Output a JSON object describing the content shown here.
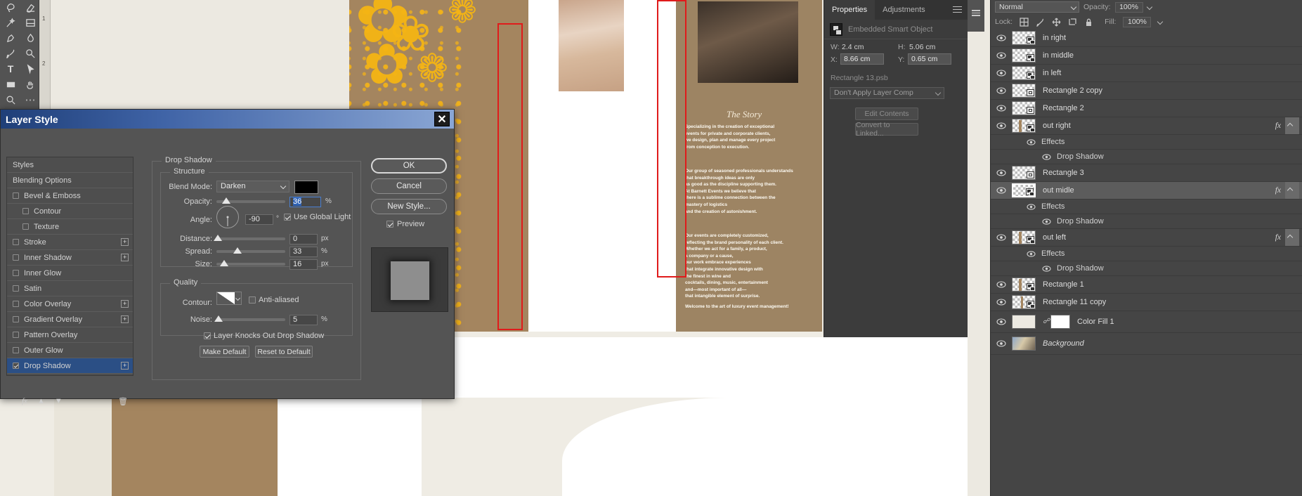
{
  "toolbar": {
    "tools": [
      {
        "name": "lasso-tool",
        "glyph": "lasso"
      },
      {
        "name": "eraser-tool",
        "glyph": "eraser"
      },
      {
        "name": "magic-wand-tool",
        "glyph": "wand"
      },
      {
        "name": "gradient-tool",
        "glyph": "gradient"
      },
      {
        "name": "pen-tool",
        "glyph": "pen"
      },
      {
        "name": "blur-tool",
        "glyph": "blur"
      },
      {
        "name": "brush-tool",
        "glyph": "brush"
      },
      {
        "name": "dodge-tool",
        "glyph": "dodge"
      },
      {
        "name": "type-tool",
        "glyph": "T"
      },
      {
        "name": "path-selection-tool",
        "glyph": "arrow"
      },
      {
        "name": "rectangle-tool",
        "glyph": "rect"
      },
      {
        "name": "hand-tool",
        "glyph": "hand"
      },
      {
        "name": "zoom-tool",
        "glyph": "zoom"
      },
      {
        "name": "more-tools",
        "glyph": "dots"
      }
    ],
    "ruler_marks": [
      "1",
      "2"
    ]
  },
  "dialog": {
    "title": "Layer Style",
    "close_label": "✕",
    "styles_header": "Styles",
    "blending_options": "Blending Options",
    "style_items": [
      {
        "label": "Bevel & Emboss",
        "checked": false,
        "indent": false,
        "plus": false
      },
      {
        "label": "Contour",
        "checked": false,
        "indent": true,
        "plus": false
      },
      {
        "label": "Texture",
        "checked": false,
        "indent": true,
        "plus": false
      },
      {
        "label": "Stroke",
        "checked": false,
        "indent": false,
        "plus": true
      },
      {
        "label": "Inner Shadow",
        "checked": false,
        "indent": false,
        "plus": true
      },
      {
        "label": "Inner Glow",
        "checked": false,
        "indent": false,
        "plus": false
      },
      {
        "label": "Satin",
        "checked": false,
        "indent": false,
        "plus": false
      },
      {
        "label": "Color Overlay",
        "checked": false,
        "indent": false,
        "plus": true
      },
      {
        "label": "Gradient Overlay",
        "checked": false,
        "indent": false,
        "plus": true
      },
      {
        "label": "Pattern Overlay",
        "checked": false,
        "indent": false,
        "plus": false
      },
      {
        "label": "Outer Glow",
        "checked": false,
        "indent": false,
        "plus": false
      },
      {
        "label": "Drop Shadow",
        "checked": true,
        "indent": false,
        "plus": true,
        "selected": true
      }
    ],
    "section_title": "Drop Shadow",
    "structure": {
      "legend": "Structure",
      "blend_mode_label": "Blend Mode:",
      "blend_mode_value": "Darken",
      "color_swatch": "#000000",
      "opacity_label": "Opacity:",
      "opacity_value": "36",
      "opacity_unit": "%",
      "angle_label": "Angle:",
      "angle_value": "-90",
      "angle_unit": "°",
      "global_light_label": "Use Global Light",
      "global_light_checked": true,
      "distance_label": "Distance:",
      "distance_value": "0",
      "distance_unit": "px",
      "spread_label": "Spread:",
      "spread_value": "33",
      "spread_unit": "%",
      "size_label": "Size:",
      "size_value": "16",
      "size_unit": "px"
    },
    "quality": {
      "legend": "Quality",
      "contour_label": "Contour:",
      "anti_aliased_label": "Anti-aliased",
      "anti_aliased_checked": false,
      "noise_label": "Noise:",
      "noise_value": "5",
      "noise_unit": "%"
    },
    "knockout_label": "Layer Knocks Out Drop Shadow",
    "knockout_checked": true,
    "make_default": "Make Default",
    "reset_default": "Reset to Default",
    "ok": "OK",
    "cancel": "Cancel",
    "new_style": "New Style...",
    "preview_label": "Preview",
    "preview_checked": true
  },
  "properties": {
    "tabs": [
      {
        "label": "Properties",
        "active": true
      },
      {
        "label": "Adjustments",
        "active": false
      }
    ],
    "object_type": "Embedded Smart Object",
    "w_label": "W:",
    "w_value": "2.4 cm",
    "h_label": "H:",
    "h_value": "5.06 cm",
    "x_label": "X:",
    "x_value": "8.66 cm",
    "y_label": "Y:",
    "y_value": "0.65 cm",
    "filename": "Rectangle 13.psb",
    "layer_comp": "Don't Apply Layer Comp",
    "edit_contents": "Edit Contents",
    "convert_to_linked": "Convert to Linked..."
  },
  "layers_panel": {
    "blend_mode": "Normal",
    "opacity_label": "Opacity:",
    "opacity_value": "100%",
    "lock_label": "Lock:",
    "fill_label": "Fill:",
    "fill_value": "100%",
    "lock_icons": [
      "transparency-lock-icon",
      "brush-lock-icon",
      "move-lock-icon",
      "artboard-lock-icon",
      "lock-all-icon"
    ],
    "layers": [
      {
        "name": "in right",
        "type": "smart",
        "visible": true
      },
      {
        "name": "in middle",
        "type": "smart",
        "visible": true
      },
      {
        "name": "in left",
        "type": "smart",
        "visible": true
      },
      {
        "name": "Rectangle 2 copy",
        "type": "vector",
        "visible": true
      },
      {
        "name": "Rectangle 2",
        "type": "vector",
        "visible": true
      },
      {
        "name": "out right",
        "type": "smart",
        "visible": true,
        "fx": true,
        "effects": [
          {
            "label": "Effects"
          },
          {
            "label": "Drop Shadow"
          }
        ]
      },
      {
        "name": "Rectangle 3",
        "type": "vector",
        "visible": true
      },
      {
        "name": "out midle",
        "type": "smart",
        "visible": true,
        "fx": true,
        "selected": true,
        "effects": [
          {
            "label": "Effects"
          },
          {
            "label": "Drop Shadow"
          }
        ]
      },
      {
        "name": "out left",
        "type": "smart",
        "visible": true,
        "fx": true,
        "effects": [
          {
            "label": "Effects"
          },
          {
            "label": "Drop Shadow"
          }
        ]
      },
      {
        "name": "Rectangle 1",
        "type": "smart",
        "visible": true
      },
      {
        "name": "Rectangle 11 copy",
        "type": "smart",
        "visible": true
      },
      {
        "name": "Color Fill 1",
        "type": "fill",
        "visible": true
      },
      {
        "name": "Background",
        "type": "background",
        "visible": true,
        "italic": true
      }
    ],
    "fx_label": "fx"
  },
  "canvas": {
    "story_heading": "The Story",
    "story_paragraphs": [
      "Specializing in the creation of exceptional\nevents for private and corporate clients,\nwe design, plan and manage every project\nfrom conception to execution.",
      "Our group of seasoned professionals understands\nthat breakthrough ideas are only\nas good as the discipline supporting them.\nAt Barnett Events we believe that\nthere is a sublime connection between the\nmastery of logistics\nand the creation of astonishment.",
      "Our events are completely customized,\nreflecting the brand personality of each client.\nWhether we act for a family, a product,\na company or a cause,\nour work embrace experiences\nthat integrate innovative design with\nthe finest in wine and\ncocktails, dining, music, entertainment\nand—most important of all—\nthat intangible element of surprise.",
      "Welcome to the art of luxury event management!"
    ]
  }
}
